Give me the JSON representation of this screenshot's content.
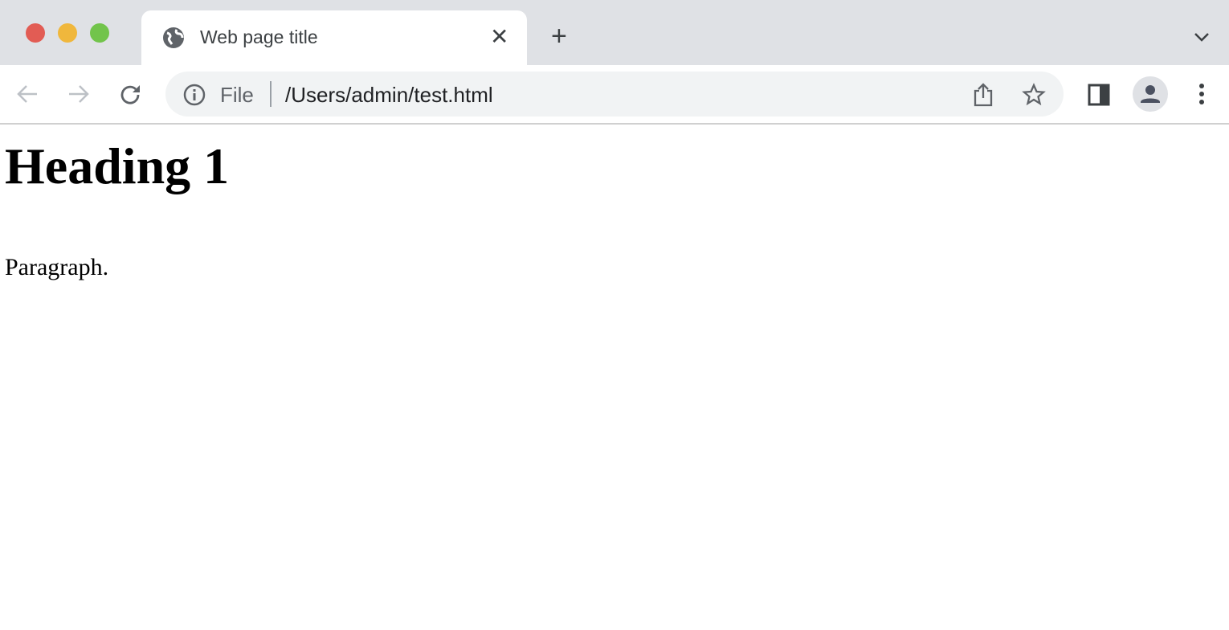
{
  "tab": {
    "title": "Web page title",
    "favicon": "globe-icon"
  },
  "address": {
    "scheme_label": "File",
    "url": "/Users/admin/test.html"
  },
  "window_controls": {
    "close": "#e25c54",
    "minimize": "#f0b73c",
    "zoom": "#72c44b"
  },
  "page": {
    "heading": "Heading 1",
    "paragraph": "Paragraph."
  }
}
